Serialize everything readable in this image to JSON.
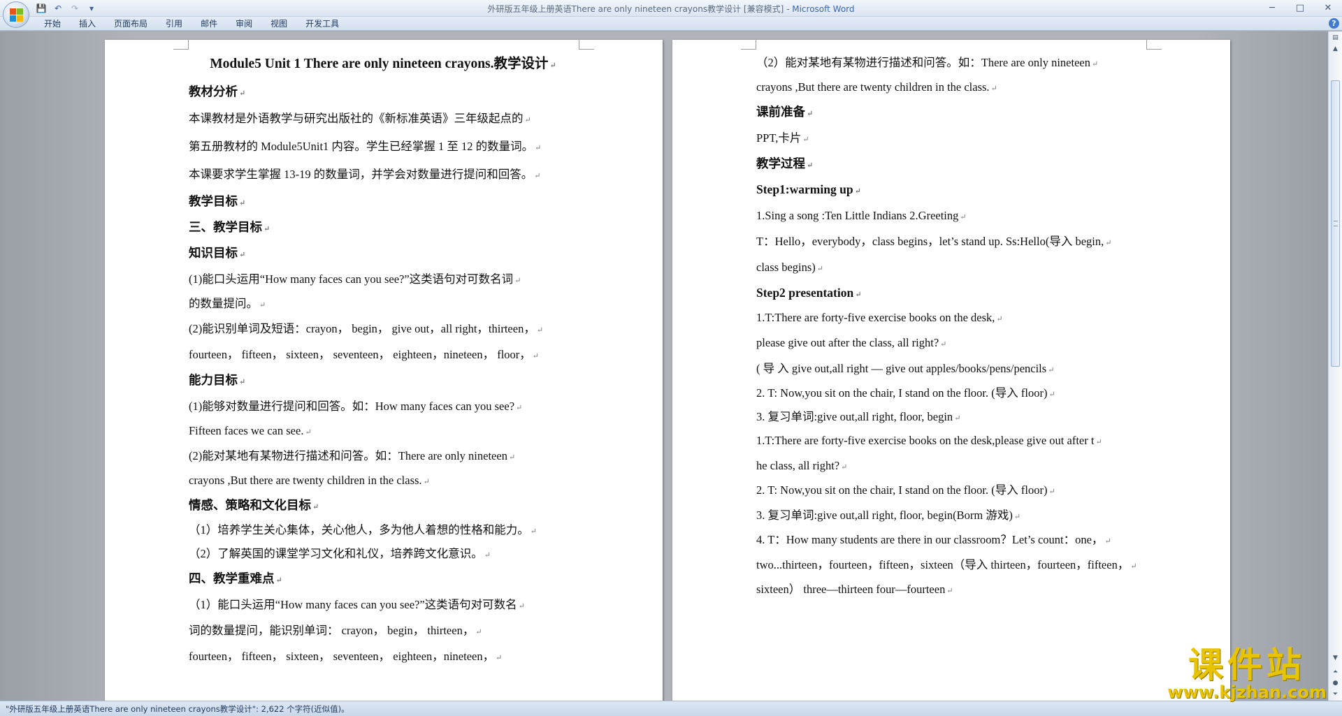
{
  "window": {
    "title": "外研版五年级上册英语There are only nineteen crayons教学设计 [兼容模式] - ",
    "app_name": "Microsoft Word"
  },
  "quick_access": {
    "save": "💾",
    "undo": "↶",
    "redo": "↷",
    "customize": "▾"
  },
  "window_controls": {
    "minimize": "─",
    "maximize": "□",
    "close": "✕"
  },
  "ribbon": {
    "tabs": [
      "开始",
      "插入",
      "页面布局",
      "引用",
      "邮件",
      "审阅",
      "视图",
      "开发工具"
    ],
    "help": "?"
  },
  "pages": {
    "left": [
      {
        "text": "Module5 Unit 1 There are only nineteen crayons.教学设计",
        "style": "title"
      },
      {
        "text": "教材分析",
        "style": "h"
      },
      {
        "text": "  本课教材是外语教学与研究出版社的《新标准英语》三年级起点的",
        "style": "tall"
      },
      {
        "text": "第五册教材的 Module5Unit1 内容。学生已经掌握 1 至 12 的数量词。",
        "style": "tall"
      },
      {
        "text": "本课要求学生掌握 13-19 的数量词，并学会对数量进行提问和回答。",
        "style": "tall"
      },
      {
        "text": "教学目标",
        "style": "h"
      },
      {
        "text": "三、教学目标",
        "style": "h"
      },
      {
        "text": "知识目标",
        "style": "h"
      },
      {
        "text": "(1)能口头运用“How many faces can you see?”这类语句对可数名词",
        "style": ""
      },
      {
        "text": "的数量提问。",
        "style": "short"
      },
      {
        "text": "(2)能识别单词及短语：crayon， begin， give out，all right，thirteen，",
        "style": ""
      },
      {
        "text": "fourteen， fifteen， sixteen， seventeen， eighteen，nineteen， floor，",
        "style": ""
      },
      {
        "text": "能力目标",
        "style": "h"
      },
      {
        "text": "(1)能够对数量进行提问和回答。如：How many faces can you see?",
        "style": ""
      },
      {
        "text": "Fifteen faces we can see.",
        "style": "short"
      },
      {
        "text": "(2)能对某地有某物进行描述和问答。如：There are only nineteen",
        "style": ""
      },
      {
        "text": "crayons ,But there are twenty children in the class.",
        "style": "short"
      },
      {
        "text": "情感、策略和文化目标",
        "style": "h"
      },
      {
        "text": "（1）培养学生关心集体，关心他人，多为他人着想的性格和能力。",
        "style": "short"
      },
      {
        "text": "（2）了解英国的课堂学习文化和礼仪，培养跨文化意识。",
        "style": "short"
      },
      {
        "text": "四、教学重难点",
        "style": "h"
      },
      {
        "text": "（1）能口头运用“How many faces can you see?”这类语句对可数名",
        "style": ""
      },
      {
        "text": "词的数量提问，能识别单词： crayon， begin， thirteen，",
        "style": ""
      },
      {
        "text": "fourteen， fifteen， sixteen， seventeen， eighteen，nineteen，",
        "style": ""
      }
    ],
    "right": [
      {
        "text": "（2）能对某地有某物进行描述和问答。如：There are only nineteen",
        "style": ""
      },
      {
        "text": "crayons ,But there are twenty children in the class.",
        "style": "short"
      },
      {
        "text": "课前准备",
        "style": "h"
      },
      {
        "text": "PPT,卡片",
        "style": ""
      },
      {
        "text": "教学过程",
        "style": "h"
      },
      {
        "text": "Step1:warming up",
        "style": "h"
      },
      {
        "text": "1.Sing a song :Ten Little Indians 2.Greeting",
        "style": ""
      },
      {
        "text": " T：Hello，everybody，class begins，let’s stand up.  Ss:Hello(导入 begin,",
        "style": ""
      },
      {
        "text": "class begins)",
        "style": ""
      },
      {
        "text": "Step2 presentation",
        "style": "h"
      },
      {
        "text": "1.T:There are forty-five exercise books on the desk,",
        "style": "short"
      },
      {
        "text": "please give out after the class, all right?",
        "style": ""
      },
      {
        "text": "(  导  入   give out,all right  —  give out apples/books/pens/pencils",
        "style": ""
      },
      {
        "text": "2. T: Now,you sit on the chair, I stand on the floor. (导入 floor)",
        "style": "short"
      },
      {
        "text": "3. 复习单词:give out,all right, floor, begin",
        "style": "short"
      },
      {
        "text": "1.T:There are forty-five exercise books on the desk,please give out after t",
        "style": "short"
      },
      {
        "text": "he class, all right?",
        "style": ""
      },
      {
        "text": "2. T: Now,you sit on the chair, I stand on the floor. (导入 floor)",
        "style": "short"
      },
      {
        "text": "3. 复习单词:give out,all right, floor, begin(Borm 游戏)",
        "style": ""
      },
      {
        "text": "4. T：How many students are there in our classroom？Let’s count：one，",
        "style": "short"
      },
      {
        "text": "two...thirteen，fourteen，fifteen，sixteen（导入 thirteen，fourteen，fifteen，",
        "style": ""
      },
      {
        "text": "sixteen） three—thirteen four—fourteen",
        "style": "short"
      }
    ]
  },
  "statusbar": {
    "text": "\"外研版五年级上册英语There are only nineteen crayons教学设计\": 2,622 个字符(近似值)。"
  },
  "watermark": {
    "title": "课件站",
    "url": "www.kjzhan.com"
  },
  "colors": {
    "accent": "#3d67a8",
    "watermark": "#e8c400"
  }
}
